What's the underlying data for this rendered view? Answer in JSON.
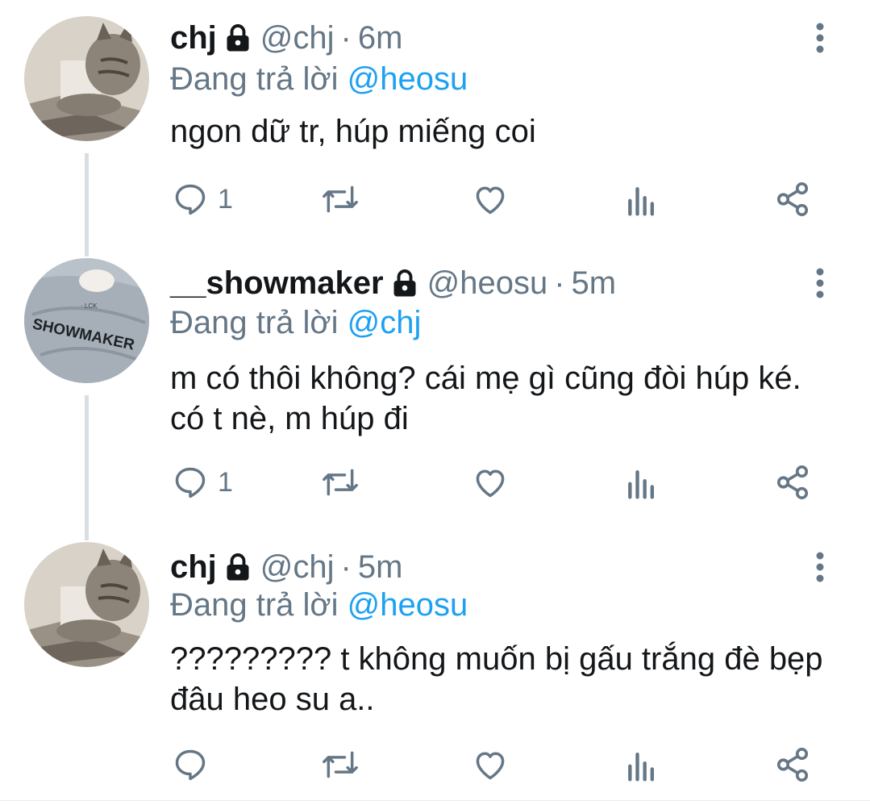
{
  "tweets": [
    {
      "display_name": "chj",
      "handle": "@chj",
      "separator": "·",
      "time": "6m",
      "replying_prefix": "Đang trả lời",
      "replying_to": "@heosu",
      "text": "ngon dữ tr, húp miếng coi",
      "reply_count": "1",
      "avatar": "cat-avatar"
    },
    {
      "display_name": "__showmaker",
      "handle": "@heosu",
      "separator": "·",
      "time": "5m",
      "replying_prefix": "Đang trả lời",
      "replying_to": "@chj",
      "text_line1": "m có thôi không? cái mẹ gì cũng đòi húp ké.",
      "text_line2": "có t nè, m húp đi",
      "reply_count": "1",
      "avatar": "jacket-avatar",
      "avatar_text": "SHOWMAKER"
    },
    {
      "display_name": "chj",
      "handle": "@chj",
      "separator": "·",
      "time": "5m",
      "replying_prefix": "Đang trả lời",
      "replying_to": "@heosu",
      "text_line1": "????????? t không muốn bị gấu trắng đè bẹp",
      "text_line2": "đâu heo su a..",
      "reply_count": "",
      "avatar": "cat-avatar"
    }
  ],
  "icons": {
    "reply": "reply-icon",
    "retweet": "retweet-icon",
    "like": "like-icon",
    "analytics": "analytics-icon",
    "share": "share-icon",
    "more": "more-vertical-icon",
    "lock": "lock-icon"
  },
  "colors": {
    "text": "#14171a",
    "secondary": "#657786",
    "mention": "#1da1f2",
    "thread_line": "#d9dee2"
  }
}
